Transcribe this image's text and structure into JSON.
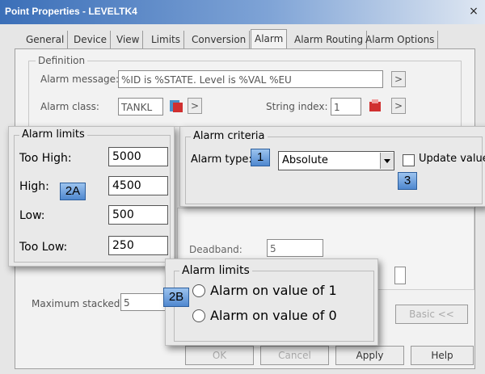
{
  "window": {
    "title": "Point Properties - LEVELTK4",
    "close_symbol": "×"
  },
  "tabs": [
    "General",
    "Device",
    "View",
    "Limits",
    "Conversion",
    "Alarm",
    "Alarm Routing",
    "Alarm Options"
  ],
  "definition": {
    "group_label": "Definition",
    "message_label": "Alarm message:",
    "message_value": "%ID is %STATE. Level is %VAL %EU",
    "class_label": "Alarm class:",
    "class_value": "TANKL",
    "string_index_label": "String index:",
    "string_index_value": "1",
    "arrow": ">"
  },
  "alarm_limits": {
    "group_label": "Alarm limits",
    "too_high_label": "Too High:",
    "too_high_value": "5000",
    "high_label": "High:",
    "high_value": "4500",
    "low_label": "Low:",
    "low_value": "500",
    "too_low_label": "Too Low:",
    "too_low_value": "250"
  },
  "alarm_criteria": {
    "group_label": "Alarm criteria",
    "type_label": "Alarm type:",
    "type_value": "Absolute",
    "update_label": "Update value"
  },
  "lower": {
    "deadband_label": "Deadband:",
    "deadband_value": "5",
    "max_stacked_label": "Maximum stacked:",
    "max_stacked_value": "5",
    "basic_button": "Basic <<"
  },
  "digital_limits": {
    "group_label": "Alarm limits",
    "option1": "Alarm on value of 1",
    "option2": "Alarm on value of 0"
  },
  "footer": {
    "ok": "OK",
    "cancel": "Cancel",
    "apply": "Apply",
    "help": "Help"
  },
  "callouts": {
    "c1": "1",
    "c2a": "2A",
    "c2b": "2B",
    "c3": "3"
  },
  "colors": {
    "title_bar": "#3b6fb8",
    "callout": "#4f87cf",
    "icon_red": "#d03030"
  }
}
